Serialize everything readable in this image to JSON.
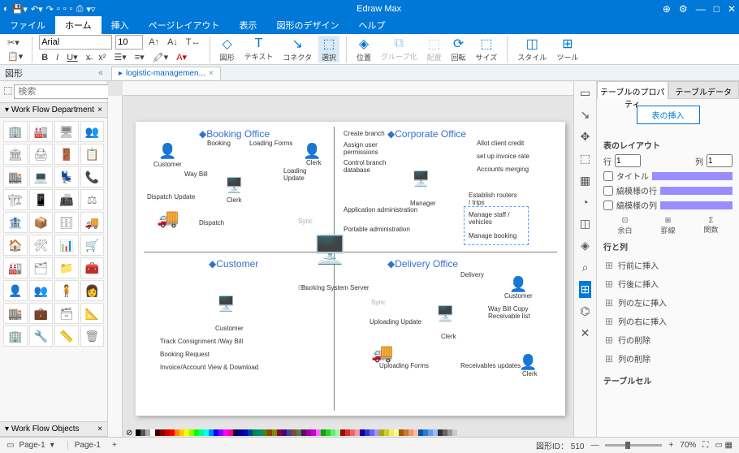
{
  "app": {
    "title": "Edraw Max"
  },
  "menu": {
    "items": [
      "ファイル",
      "ホーム",
      "挿入",
      "ページレイアウト",
      "表示",
      "図形のデザイン",
      "ヘルプ"
    ],
    "active": 1
  },
  "font": {
    "family": "Arial",
    "size": "10"
  },
  "ribbon_tools": [
    "図形",
    "テキスト",
    "コネクタ",
    "選択",
    "位置",
    "グループ化",
    "配置",
    "回転",
    "サイズ",
    "スタイル",
    "ツール"
  ],
  "sidebar": {
    "title": "図形",
    "search_placeholder": "検索",
    "sections": [
      "Work Flow Department",
      "Work Flow Objects"
    ]
  },
  "doc_tab": "logistic-managemen...",
  "canvas": {
    "quadrants": {
      "booking": "Booking Office",
      "corporate": "Corporate Office",
      "customer": "Customer",
      "delivery": "Delivery Office"
    },
    "labels": {
      "booking_txt": "Booking",
      "loading_forms": "Loading Forms",
      "loading_update": "Loading Update",
      "clerk": "Clerk",
      "customer": "Customer",
      "waybill": "Way Bill",
      "dispatch_update": "Dispatch Update",
      "dispatch": "Dispatch",
      "track": "Track Consignment /Way Bill",
      "booking_req": "Booking Request",
      "invoice": "Invoice/Account View & Download",
      "create_branch": "Create branch",
      "assign_user": "Assign user permissions",
      "control_branch": "Control branch database",
      "app_admin": "Application administration",
      "portable_admin": "Portable administration",
      "allot_credit": "Allot client credit",
      "setup_invoice": "set up invoice rate",
      "accounts_merging": "Accounts merging",
      "establish_routers": "Establish routers / trips",
      "manage_staff": "Manage staff / vehicles",
      "manage_booking": "Manage booking",
      "manager": "Manager",
      "server": "Booking System Server",
      "delivery_txt": "Delivery",
      "uploading_update": "Uploading Update",
      "uploading_forms": "Uploading Forms",
      "waybill_copy": "Way Bill Copy Receivable list",
      "receivables_updates": "Receivables updates",
      "browse": "Browse",
      "sync": "Sync"
    }
  },
  "right": {
    "tabs": [
      "テーブルのプロパティ",
      "テーブルデータ"
    ],
    "insert": "表の挿入",
    "layout_label": "表のレイアウト",
    "row_label": "行",
    "col_label": "列",
    "row_val": 1,
    "col_val": 1,
    "opt1": "タイトル",
    "opt2": "縞模様の行",
    "opt3": "縞模様の列",
    "triple": [
      "余白",
      "罫線",
      "関数"
    ],
    "rows_cols_label": "行と列",
    "items": [
      "行前に挿入",
      "行後に挿入",
      "列の左に挿入",
      "列の右に挿入",
      "行の削除",
      "列の削除"
    ],
    "cell_label": "テーブルセル"
  },
  "status": {
    "page_tab": "Page-1",
    "page_list": "Page-1",
    "id_label": "図形ID：",
    "id_val": "510",
    "zoom": "70%"
  },
  "colorstrip": [
    "#000",
    "#555",
    "#aaa",
    "#fff",
    "#400",
    "#800",
    "#c00",
    "#f00",
    "#f80",
    "#fc0",
    "#ff0",
    "#8f0",
    "#0f0",
    "#0f8",
    "#0ff",
    "#08f",
    "#00f",
    "#80f",
    "#f0f",
    "#f08",
    "#004",
    "#008",
    "#00c",
    "#048",
    "#084",
    "#088",
    "#480",
    "#840",
    "#880",
    "#804",
    "#408",
    "#448",
    "#844",
    "#484",
    "#606",
    "#909",
    "#c0c",
    "#f6f",
    "#0a0",
    "#3c3",
    "#6e6",
    "#9f9",
    "#a00",
    "#c33",
    "#e66",
    "#f99",
    "#00a",
    "#33c",
    "#66e",
    "#99f",
    "#aa0",
    "#cc3",
    "#ee6",
    "#ff9",
    "#a50",
    "#c73",
    "#e96",
    "#fb9",
    "#05a",
    "#37c",
    "#69e",
    "#9bf",
    "#333",
    "#666",
    "#999",
    "#ccc"
  ]
}
